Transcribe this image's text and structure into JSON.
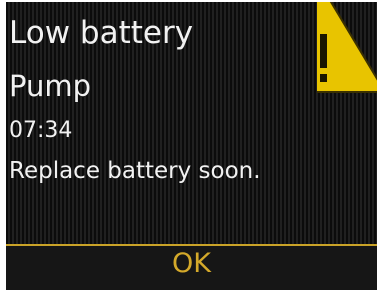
{
  "alert": {
    "title": "Low battery",
    "source": "Pump",
    "time": "07:34",
    "message": "Replace battery soon.",
    "icon": "warning-triangle-icon"
  },
  "softkey": {
    "ok_label": "OK"
  },
  "colors": {
    "accent": "#d4a92a",
    "background": "#111111",
    "text": "#f2f2f2",
    "warning": "#e8c400"
  }
}
